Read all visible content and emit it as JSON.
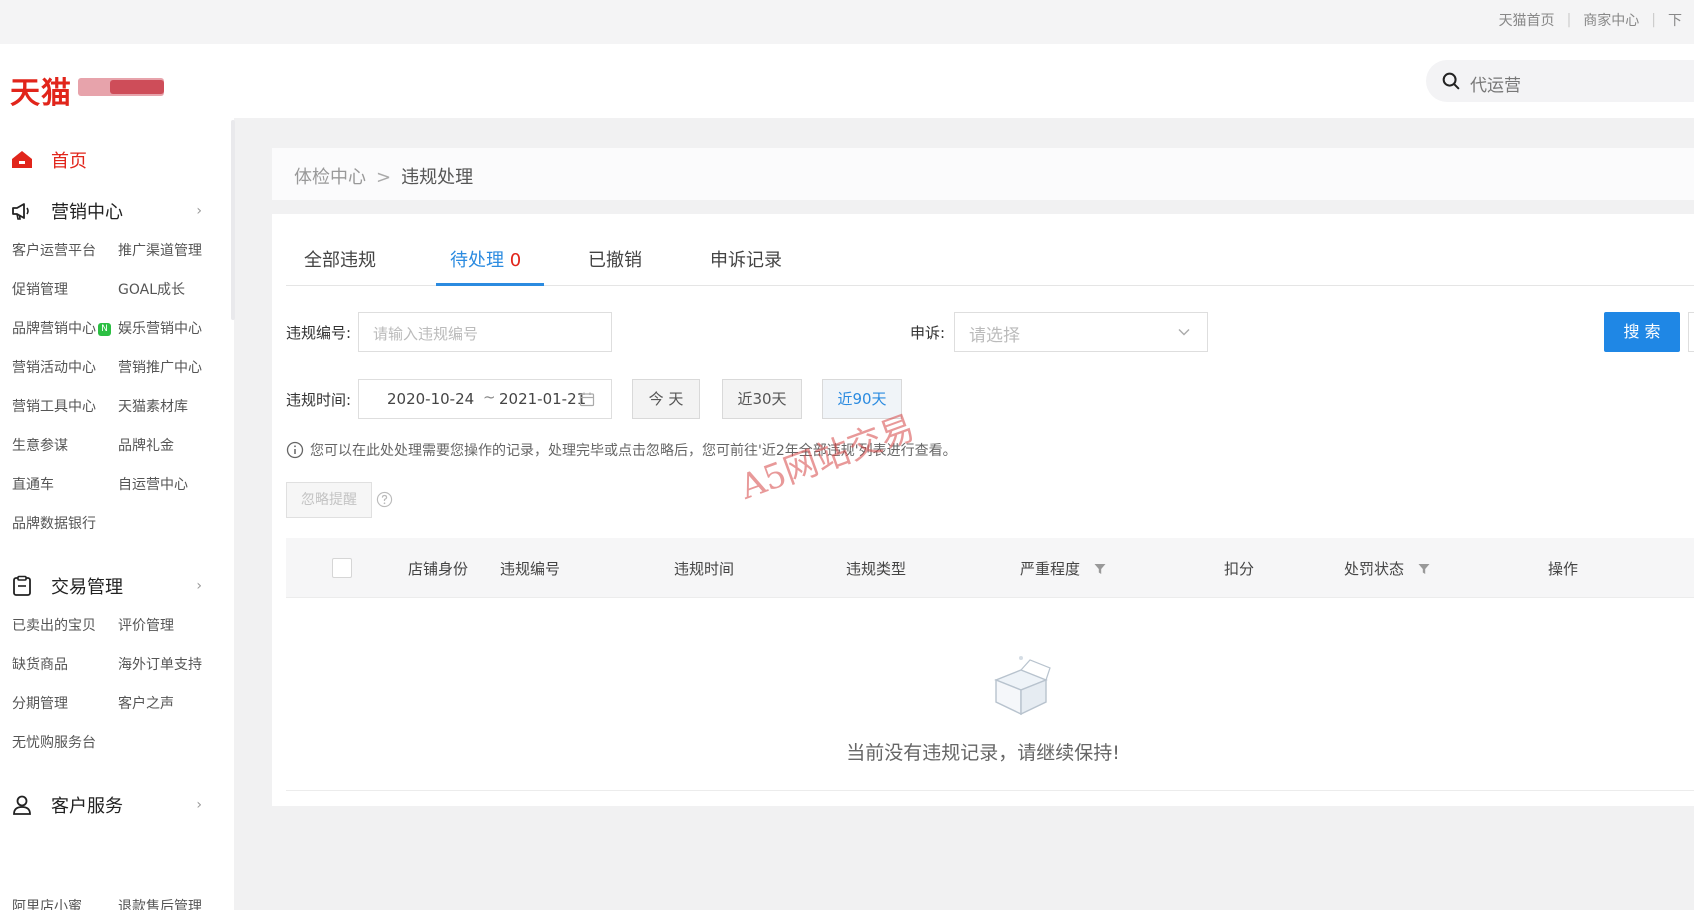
{
  "top_links": [
    "天猫首页",
    "商家中心",
    "下"
  ],
  "logo_text": "天猫",
  "search": {
    "value": "代运营"
  },
  "sidebar": {
    "home": "首页",
    "sections": [
      {
        "title": "营销中心",
        "chevron": "›",
        "items": [
          "客户运营平台",
          "推广渠道管理",
          "促销管理",
          "GOAL成长",
          "品牌营销中心",
          "娱乐营销中心",
          "营销活动中心",
          "营销推广中心",
          "营销工具中心",
          "天猫素材库",
          "生意参谋",
          "品牌礼金",
          "直通车",
          "自运营中心",
          "品牌数据银行"
        ]
      },
      {
        "title": "交易管理",
        "chevron": "›",
        "items": [
          "已卖出的宝贝",
          "评价管理",
          "缺货商品",
          "海外订单支持",
          "分期管理",
          "客户之声",
          "无忧购服务台"
        ]
      },
      {
        "title": "客户服务",
        "chevron": "›",
        "items": [
          "阿里店小蜜",
          "退款售后管理"
        ]
      }
    ],
    "new_badge": "N"
  },
  "breadcrumb": {
    "parent": "体检中心",
    "separator": ">",
    "current": "违规处理"
  },
  "tabs": [
    {
      "label": "全部违规"
    },
    {
      "label": "待处理",
      "count": "0"
    },
    {
      "label": "已撤销"
    },
    {
      "label": "申诉记录"
    }
  ],
  "filters": {
    "violation_no_label": "违规编号:",
    "violation_no_placeholder": "请输入违规编号",
    "appeal_label": "申诉:",
    "appeal_placeholder": "请选择",
    "search_button": "搜 索",
    "time_label": "违规时间:",
    "date_start": "2020-10-24",
    "date_sep": "~",
    "date_end": "2021-01-21",
    "quick_today": "今 天",
    "quick_30": "近30天",
    "quick_90": "近90天"
  },
  "notice": "您可以在此处处理需要您操作的记录，处理完毕或点击忽略后，您可前往'近2年全部违规'列表进行查看。",
  "ignore_button": "忽略提醒",
  "table": {
    "headers": [
      "店铺身份",
      "违规编号",
      "违规时间",
      "违规类型",
      "严重程度",
      "扣分",
      "处罚状态",
      "操作"
    ]
  },
  "empty_text": "当前没有违规记录，请继续保持!",
  "watermark": "A5网站交易",
  "colors": {
    "brand_red": "#e1251b",
    "accent_blue": "#2b8be0",
    "button_blue": "#1f87e5"
  }
}
